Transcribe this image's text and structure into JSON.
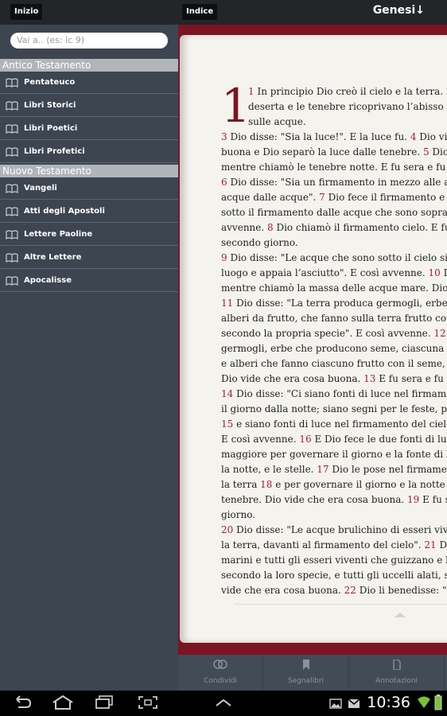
{
  "header": {
    "home_label": "Inizio",
    "index_label": "Indice",
    "book_title": "Genesi↓"
  },
  "sidebar": {
    "search_placeholder": "Vai a.. (es: lc 9)",
    "sections": [
      {
        "title": "Antico Testamento",
        "items": [
          "Pentateuco",
          "Libri Storici",
          "Libri Poetici",
          "Libri Profetici"
        ]
      },
      {
        "title": "Nuovo Testamento",
        "items": [
          "Vangeli",
          "Atti degli Apostoli",
          "Lettere Paoline",
          "Altre Lettere",
          "Apocalisse"
        ]
      }
    ]
  },
  "reader": {
    "chapter_number": "1",
    "lines": [
      [
        {
          "v": "1"
        },
        {
          "t": " In principio Dio creò il cielo e la terra. "
        },
        {
          "v": "2"
        },
        {
          "t": " L"
        }
      ],
      [
        {
          "t": "deserta e le tenebre ricoprivano l’abisso e lo"
        }
      ],
      [
        {
          "t": "sulle acque."
        }
      ],
      [
        {
          "v": "3"
        },
        {
          "t": " Dio disse: \"Sia la luce!\". E la luce fu. "
        },
        {
          "v": "4"
        },
        {
          "t": " Dio vide"
        }
      ],
      [
        {
          "t": "buona e Dio separò la luce dalle tenebre. "
        },
        {
          "v": "5"
        },
        {
          "t": " Dio ch"
        }
      ],
      [
        {
          "t": "mentre chiamò le tenebre notte. E fu sera e fu ma"
        }
      ],
      [
        {
          "v": "6"
        },
        {
          "t": " Dio disse: \"Sia un firmamento in mezzo alle ac"
        }
      ],
      [
        {
          "t": "acque dalle acque\". "
        },
        {
          "v": "7"
        },
        {
          "t": " Dio fece il firmamento e sep"
        }
      ],
      [
        {
          "t": "sotto il firmamento dalle acque che sono sopra il"
        }
      ],
      [
        {
          "t": "avvenne. "
        },
        {
          "v": "8"
        },
        {
          "t": " Dio chiamò il firmamento cielo. E fu s"
        }
      ],
      [
        {
          "t": "secondo giorno."
        }
      ],
      [
        {
          "v": "9"
        },
        {
          "t": " Dio disse: \"Le acque che sono sotto il cielo si ra"
        }
      ],
      [
        {
          "t": "luogo e appaia l’asciutto\". E così avvenne. "
        },
        {
          "v": "10"
        },
        {
          "t": " Dio"
        }
      ],
      [
        {
          "t": "mentre chiamò la massa delle acque mare. Dio vi"
        }
      ],
      [
        {
          "v": "11"
        },
        {
          "t": " Dio disse: \"La terra produca germogli, erbe ch"
        }
      ],
      [
        {
          "t": "alberi da frutto, che fanno sulla terra frutto con il"
        }
      ],
      [
        {
          "t": "secondo la propria specie\". E così avvenne. "
        },
        {
          "v": "12"
        },
        {
          "t": " E l"
        }
      ],
      [
        {
          "t": "germogli, erbe che producono seme, ciascuna sec"
        }
      ],
      [
        {
          "t": "e alberi che fanno ciascuno frutto con il seme, se"
        }
      ],
      [
        {
          "t": "Dio vide che era cosa buona. "
        },
        {
          "v": "13"
        },
        {
          "t": " E fu sera e fu ma"
        }
      ],
      [
        {
          "v": "14"
        },
        {
          "t": " Dio disse: \"Ci siano fonti di luce nel firmamen"
        }
      ],
      [
        {
          "t": "il giorno dalla notte; siano segni per le feste, per"
        }
      ],
      [
        {
          "v": "15"
        },
        {
          "t": " e siano fonti di luce nel firmamento del cielo p"
        }
      ],
      [
        {
          "t": "E così avvenne. "
        },
        {
          "v": "16"
        },
        {
          "t": " E Dio fece le due fonti di luce"
        }
      ],
      [
        {
          "t": "maggiore per governare il giorno e la fonte di luc"
        }
      ],
      [
        {
          "t": "la notte, e le stelle. "
        },
        {
          "v": "17"
        },
        {
          "t": " Dio le pose nel firmamento"
        }
      ],
      [
        {
          "t": "la terra "
        },
        {
          "v": "18"
        },
        {
          "t": " e per governare il giorno e la notte e p"
        }
      ],
      [
        {
          "t": "tenebre. Dio vide che era cosa buona. "
        },
        {
          "v": "19"
        },
        {
          "t": " E fu sera"
        }
      ],
      [
        {
          "t": "giorno."
        }
      ],
      [
        {
          "v": "20"
        },
        {
          "t": " Dio disse: \"Le acque brulichino di esseri vive"
        }
      ],
      [
        {
          "t": "la terra, davanti al firmamento del cielo\". "
        },
        {
          "v": "21"
        },
        {
          "t": " Dio"
        }
      ],
      [
        {
          "t": "marini e tutti gli esseri viventi che guizzano e bru"
        }
      ],
      [
        {
          "t": "secondo la loro specie, e tutti gli uccelli alati, sec"
        }
      ],
      [
        {
          "t": "vide che era cosa buona. "
        },
        {
          "v": "22"
        },
        {
          "t": " Dio li benedisse: \"Sia"
        }
      ]
    ]
  },
  "tabs": [
    {
      "label": "Condividi",
      "icon": "share-rings-icon"
    },
    {
      "label": "Segnalibri",
      "icon": "bookmark-icon"
    },
    {
      "label": "Annotazioni",
      "icon": "note-icon"
    }
  ],
  "status_bar": {
    "time": "10:36"
  },
  "colors": {
    "accent": "#7b1521",
    "verse_number": "#a31f31",
    "sidebar_bg": "#3d4550",
    "section_header": "#b0b5ba"
  }
}
